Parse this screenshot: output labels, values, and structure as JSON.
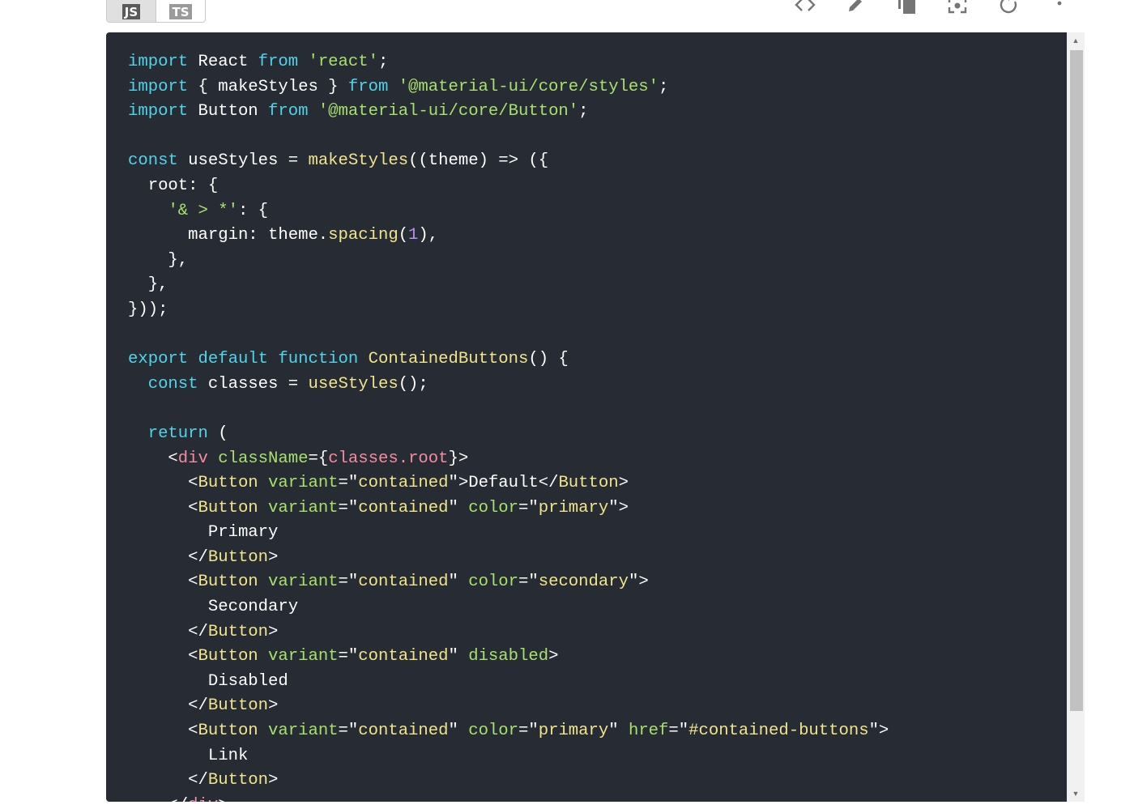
{
  "lang_toggle": {
    "js_label": "JS",
    "ts_label": "TS"
  },
  "toolbar": {
    "icons": [
      "code-icon",
      "edit-icon",
      "copy-icon",
      "screenshot-icon",
      "reset-icon",
      "more-vert-icon"
    ]
  },
  "code": {
    "lines": [
      [
        [
          "k",
          "import"
        ],
        [
          "p",
          " React "
        ],
        [
          "k",
          "from"
        ],
        [
          "p",
          " "
        ],
        [
          "s",
          "'react'"
        ],
        [
          "p",
          ";"
        ]
      ],
      [
        [
          "k",
          "import"
        ],
        [
          "p",
          " { makeStyles } "
        ],
        [
          "k",
          "from"
        ],
        [
          "p",
          " "
        ],
        [
          "s",
          "'@material-ui/core/styles'"
        ],
        [
          "p",
          ";"
        ]
      ],
      [
        [
          "k",
          "import"
        ],
        [
          "p",
          " Button "
        ],
        [
          "k",
          "from"
        ],
        [
          "p",
          " "
        ],
        [
          "s",
          "'@material-ui/core/Button'"
        ],
        [
          "p",
          ";"
        ]
      ],
      [
        [
          "p",
          ""
        ]
      ],
      [
        [
          "k",
          "const"
        ],
        [
          "p",
          " useStyles = "
        ],
        [
          "f",
          "makeStyles"
        ],
        [
          "p",
          "((theme) => ({"
        ]
      ],
      [
        [
          "p",
          "  root: {"
        ]
      ],
      [
        [
          "p",
          "    "
        ],
        [
          "s",
          "'& > *'"
        ],
        [
          "p",
          ": {"
        ]
      ],
      [
        [
          "p",
          "      margin: theme."
        ],
        [
          "f",
          "spacing"
        ],
        [
          "p",
          "("
        ],
        [
          "n",
          "1"
        ],
        [
          "p",
          "),"
        ]
      ],
      [
        [
          "p",
          "    },"
        ]
      ],
      [
        [
          "p",
          "  },"
        ]
      ],
      [
        [
          "p",
          "}));"
        ]
      ],
      [
        [
          "p",
          ""
        ]
      ],
      [
        [
          "k",
          "export"
        ],
        [
          "p",
          " "
        ],
        [
          "k",
          "default"
        ],
        [
          "p",
          " "
        ],
        [
          "k",
          "function"
        ],
        [
          "p",
          " "
        ],
        [
          "f",
          "ContainedButtons"
        ],
        [
          "p",
          "() {"
        ]
      ],
      [
        [
          "p",
          "  "
        ],
        [
          "k",
          "const"
        ],
        [
          "p",
          " classes = "
        ],
        [
          "f",
          "useStyles"
        ],
        [
          "p",
          "();"
        ]
      ],
      [
        [
          "p",
          ""
        ]
      ],
      [
        [
          "p",
          "  "
        ],
        [
          "k",
          "return"
        ],
        [
          "p",
          " ("
        ]
      ],
      [
        [
          "p",
          "    <"
        ],
        [
          "t",
          "div"
        ],
        [
          "p",
          " "
        ],
        [
          "a",
          "className"
        ],
        [
          "p",
          "={"
        ],
        [
          "t",
          "classes"
        ],
        [
          "t",
          "."
        ],
        [
          "t",
          "root"
        ],
        [
          "p",
          "}>"
        ]
      ],
      [
        [
          "p",
          "      <"
        ],
        [
          "c",
          "Button"
        ],
        [
          "p",
          " "
        ],
        [
          "a",
          "variant"
        ],
        [
          "p",
          "=\""
        ],
        [
          "av",
          "contained"
        ],
        [
          "p",
          "\">Default</"
        ],
        [
          "c",
          "Button"
        ],
        [
          "p",
          ">"
        ]
      ],
      [
        [
          "p",
          "      <"
        ],
        [
          "c",
          "Button"
        ],
        [
          "p",
          " "
        ],
        [
          "a",
          "variant"
        ],
        [
          "p",
          "=\""
        ],
        [
          "av",
          "contained"
        ],
        [
          "p",
          "\" "
        ],
        [
          "a",
          "color"
        ],
        [
          "p",
          "=\""
        ],
        [
          "av",
          "primary"
        ],
        [
          "p",
          "\">"
        ]
      ],
      [
        [
          "p",
          "        Primary"
        ]
      ],
      [
        [
          "p",
          "      </"
        ],
        [
          "c",
          "Button"
        ],
        [
          "p",
          ">"
        ]
      ],
      [
        [
          "p",
          "      <"
        ],
        [
          "c",
          "Button"
        ],
        [
          "p",
          " "
        ],
        [
          "a",
          "variant"
        ],
        [
          "p",
          "=\""
        ],
        [
          "av",
          "contained"
        ],
        [
          "p",
          "\" "
        ],
        [
          "a",
          "color"
        ],
        [
          "p",
          "=\""
        ],
        [
          "av",
          "secondary"
        ],
        [
          "p",
          "\">"
        ]
      ],
      [
        [
          "p",
          "        Secondary"
        ]
      ],
      [
        [
          "p",
          "      </"
        ],
        [
          "c",
          "Button"
        ],
        [
          "p",
          ">"
        ]
      ],
      [
        [
          "p",
          "      <"
        ],
        [
          "c",
          "Button"
        ],
        [
          "p",
          " "
        ],
        [
          "a",
          "variant"
        ],
        [
          "p",
          "=\""
        ],
        [
          "av",
          "contained"
        ],
        [
          "p",
          "\" "
        ],
        [
          "a",
          "disabled"
        ],
        [
          "p",
          ">"
        ]
      ],
      [
        [
          "p",
          "        Disabled"
        ]
      ],
      [
        [
          "p",
          "      </"
        ],
        [
          "c",
          "Button"
        ],
        [
          "p",
          ">"
        ]
      ],
      [
        [
          "p",
          "      <"
        ],
        [
          "c",
          "Button"
        ],
        [
          "p",
          " "
        ],
        [
          "a",
          "variant"
        ],
        [
          "p",
          "=\""
        ],
        [
          "av",
          "contained"
        ],
        [
          "p",
          "\" "
        ],
        [
          "a",
          "color"
        ],
        [
          "p",
          "=\""
        ],
        [
          "av",
          "primary"
        ],
        [
          "p",
          "\" "
        ],
        [
          "a",
          "href"
        ],
        [
          "p",
          "=\""
        ],
        [
          "av",
          "#contained-buttons"
        ],
        [
          "p",
          "\">"
        ]
      ],
      [
        [
          "p",
          "        Link"
        ]
      ],
      [
        [
          "p",
          "      </"
        ],
        [
          "c",
          "Button"
        ],
        [
          "p",
          ">"
        ]
      ],
      [
        [
          "p",
          "    </"
        ],
        [
          "t",
          "div"
        ],
        [
          "p",
          ">"
        ]
      ]
    ]
  },
  "scrollbar": {
    "up_arrow": "▲",
    "down_arrow": "▼",
    "scroll_position": 0.0
  },
  "colors": {
    "code_background": "#272c34",
    "keyword": "#4fd4ec",
    "string": "#a7e06b",
    "function": "#f2e48a",
    "number": "#b98ef3",
    "tag": "#f58aa0"
  }
}
